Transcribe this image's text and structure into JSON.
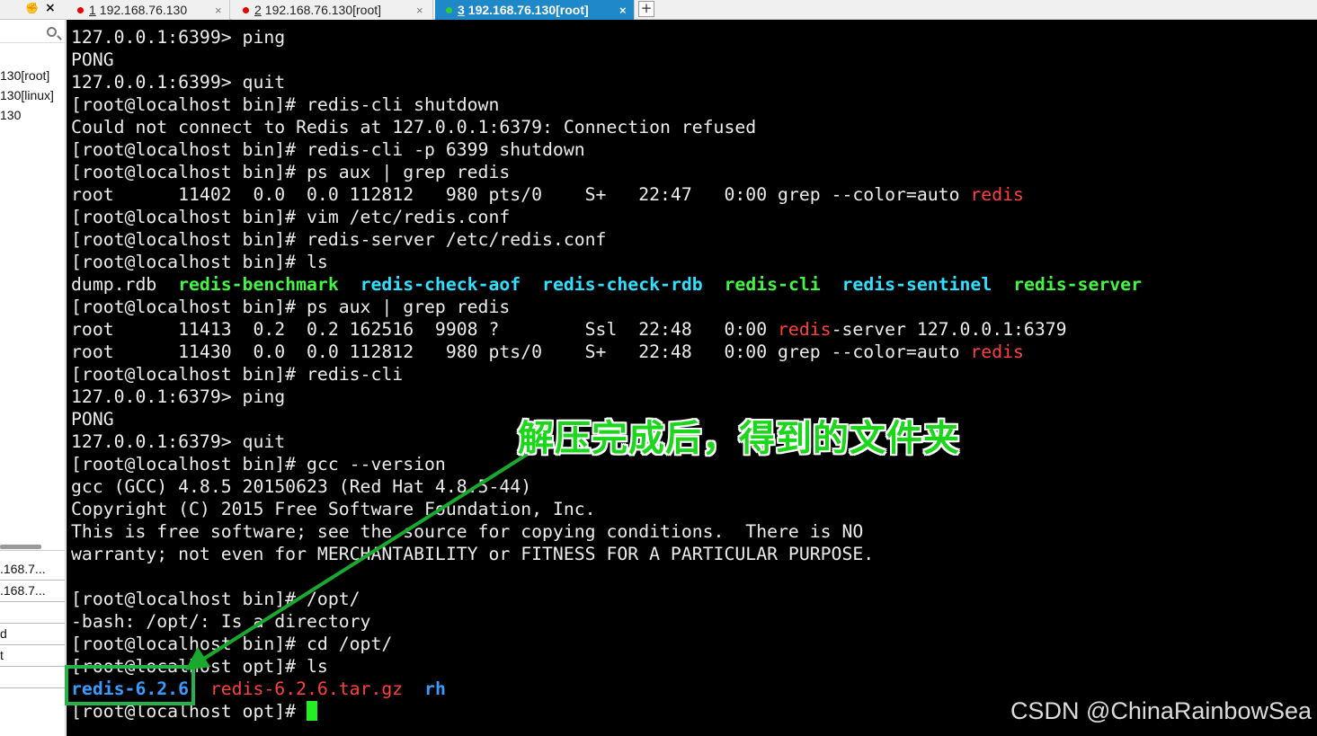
{
  "tabbar": {
    "pin_icon": "pin-icon",
    "close_all": "×",
    "tabs": [
      {
        "num": "1",
        "label": " 192.168.76.130",
        "close": "×",
        "status_color": "#e00000"
      },
      {
        "num": "2",
        "label": " 192.168.76.130[root]",
        "close": "×",
        "status_color": "#e00000"
      },
      {
        "num": "3",
        "label": " 192.168.76.130[root]",
        "close": "×",
        "status_color": "#33cc33",
        "active": true
      }
    ],
    "add_tab": "+"
  },
  "sidebar": {
    "search_icon": "search-icon",
    "sessions": [
      "130[root]",
      "130[linux]",
      "130"
    ],
    "lower_items": [
      ".168.7...",
      ".168.7...",
      "",
      "",
      ""
    ],
    "bottom_items": [
      "d",
      "t"
    ]
  },
  "terminal": {
    "lines": [
      "127.0.0.1:6399> ping",
      "PONG",
      "127.0.0.1:6399> quit",
      "[root@localhost bin]# redis-cli shutdown",
      "Could not connect to Redis at 127.0.0.1:6379: Connection refused",
      "[root@localhost bin]# redis-cli -p 6399 shutdown",
      "[root@localhost bin]# ps aux | grep redis",
      "root      11402  0.0  0.0 112812   980 pts/0    S+   22:47   0:00 grep --color=auto ",
      "[root@localhost bin]# vim /etc/redis.conf",
      "[root@localhost bin]# redis-server /etc/redis.conf",
      "[root@localhost bin]# ls",
      "dump.rdb  ",
      "[root@localhost bin]# ps aux | grep redis",
      "root      11413  0.2  0.2 162516  9908 ?        Ssl  22:48   0:00 ",
      "root      11430  0.0  0.0 112812   980 pts/0    S+   22:48   0:00 grep --color=auto ",
      "[root@localhost bin]# redis-cli",
      "127.0.0.1:6379> ping",
      "PONG",
      "127.0.0.1:6379> quit",
      "[root@localhost bin]# gcc --version",
      "gcc (GCC) 4.8.5 20150623 (Red Hat 4.8.5-44)",
      "Copyright (C) 2015 Free Software Foundation, Inc.",
      "This is free software; see the source for copying conditions.  There is NO",
      "warranty; not even for MERCHANTABILITY or FITNESS FOR A PARTICULAR PURPOSE.",
      "",
      "[root@localhost bin]# /opt/",
      "-bash: /opt/: Is a directory",
      "[root@localhost bin]# cd /opt/",
      "[root@localhost opt]# ls",
      "",
      "[root@localhost opt]# "
    ],
    "grep_match": "redis",
    "redis_server_rest": "-server 127.0.0.1:6379",
    "ls_bin": [
      "redis-benchmark",
      "redis-check-aof",
      "redis-check-rdb",
      "redis-cli",
      "redis-sentinel",
      "redis-server"
    ],
    "ls_opt": {
      "dir": "redis-6.2.6",
      "archive": "redis-6.2.6.tar.gz",
      "other": "rh"
    },
    "colors": {
      "background": "#000000",
      "text": "#ececec",
      "match": "#ff4040",
      "exec": "#44f544",
      "exec_cyan": "#2fe0ff",
      "dir": "#3a9bff",
      "cursor": "#22ee22"
    }
  },
  "annotation": {
    "text": "解压完成后，得到的文件夹",
    "color": "#1bd61b",
    "box_color": "#27b14a"
  },
  "watermark": "CSDN @ChinaRainbowSea"
}
